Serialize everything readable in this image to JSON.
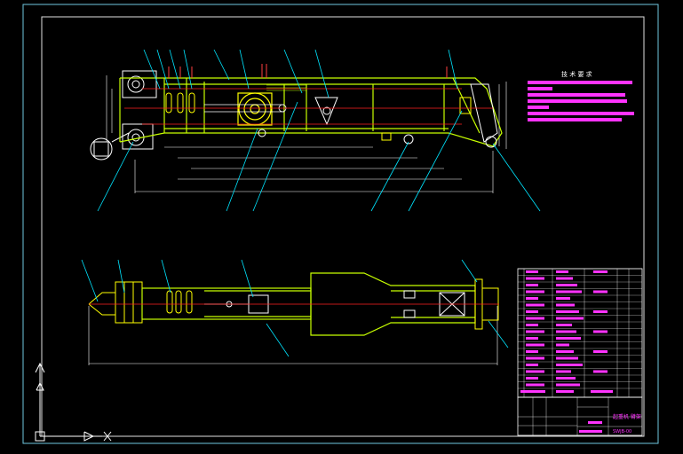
{
  "drawing": {
    "tech_req_title": "技 术 要 求",
    "title_block": {
      "drawing_name": "起重机 臂架",
      "drawing_code": "SWJB-00"
    },
    "colors": {
      "background": "#000000",
      "frame": "#6fc8e0",
      "structure": "#c8ff00",
      "yellow": "#ffff00",
      "centerline": "#ff2020",
      "leader": "#00e5ff",
      "text": "#ffffff",
      "magenta": "#ff33ff"
    },
    "icons": [
      "ucs-axis-icon"
    ]
  }
}
